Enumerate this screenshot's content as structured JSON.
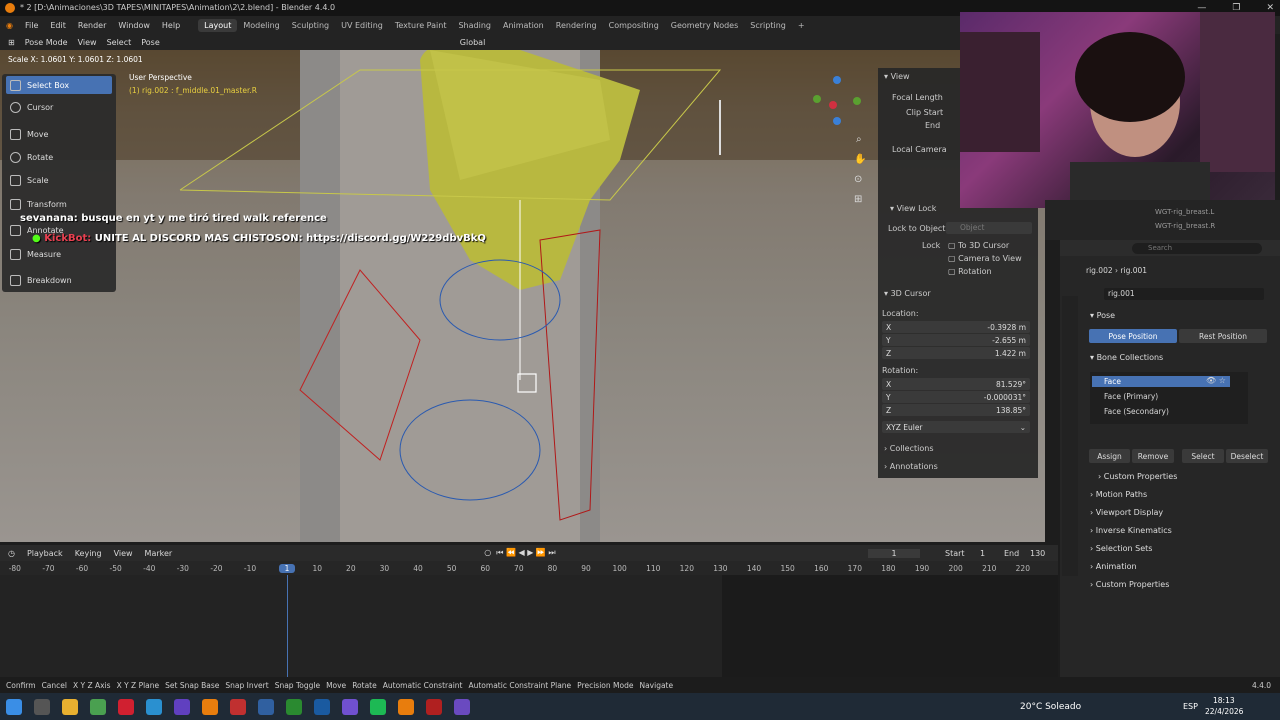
{
  "window": {
    "title": "* 2 [D:\\Animaciones\\3D TAPES\\MINITAPES\\Animation\\2\\2.blend] - Blender 4.4.0"
  },
  "menu": [
    "File",
    "Edit",
    "Render",
    "Window",
    "Help"
  ],
  "workspaces": [
    "Layout",
    "Modeling",
    "Sculpting",
    "UV Editing",
    "Texture Paint",
    "Shading",
    "Animation",
    "Rendering",
    "Compositing",
    "Geometry Nodes",
    "Scripting"
  ],
  "viewport_header": {
    "mode": "Pose Mode",
    "view": "View",
    "select": "Select",
    "pose": "Pose",
    "orientation": "Global"
  },
  "scale_readout": "Scale X: 1.0601   Y: 1.0601   Z: 1.0601",
  "overlay_text": {
    "perspective": "User Perspective",
    "object": "(1) rig.002 : f_middle.01_master.R"
  },
  "tools": [
    "Select Box",
    "Cursor",
    "Move",
    "Rotate",
    "Scale",
    "Transform",
    "Annotate",
    "Measure",
    "Breakdown"
  ],
  "chat": [
    {
      "user": "sevanana:",
      "msg": "busque en yt y me tiró tired walk reference"
    },
    {
      "user": "KickBot:",
      "msg": "UNITE AL DISCORD MAS CHISTOSON: https://discord.gg/W229dbvBkQ"
    }
  ],
  "npanel": {
    "view_title": "View",
    "focal_length": "Focal Length",
    "clip_start": "Clip Start",
    "end": "End",
    "local_camera": "Local Camera",
    "view_lock": "View Lock",
    "lock_to_object": "Lock to Object",
    "object_placeholder": "Object",
    "lock": "Lock",
    "to_3d_cursor": "To 3D Cursor",
    "camera_to_view": "Camera to View",
    "rotation": "Rotation",
    "cursor_title": "3D Cursor",
    "location": "Location:",
    "loc": [
      {
        "k": "X",
        "v": "-0.3928 m"
      },
      {
        "k": "Y",
        "v": "-2.655 m"
      },
      {
        "k": "Z",
        "v": "1.422 m"
      }
    ],
    "rotation_label": "Rotation:",
    "rot": [
      {
        "k": "X",
        "v": "81.529°"
      },
      {
        "k": "Y",
        "v": "-0.000031°"
      },
      {
        "k": "Z",
        "v": "138.85°"
      }
    ],
    "euler": "XYZ Euler",
    "collections": "Collections",
    "annotations": "Annotations"
  },
  "outliner": [
    "WGT-rig_breast.L",
    "WGT-rig_breast.R"
  ],
  "props": {
    "search_placeholder": "Search",
    "breadcrumb": [
      "rig.002",
      "rig.001"
    ],
    "armature": "rig.001",
    "pose": "Pose",
    "pose_position": "Pose Position",
    "rest_position": "Rest Position",
    "bone_collections": "Bone Collections",
    "collections": [
      "Face",
      "Face (Primary)",
      "Face (Secondary)"
    ],
    "assign": "Assign",
    "remove": "Remove",
    "select": "Select",
    "deselect": "Deselect",
    "custom_props_inner": "Custom Properties",
    "sections": [
      "Motion Paths",
      "Viewport Display",
      "Inverse Kinematics",
      "Selection Sets",
      "Animation",
      "Custom Properties"
    ]
  },
  "timeline": {
    "playback": "Playback",
    "keying": "Keying",
    "view": "View",
    "marker": "Marker",
    "frame": "1",
    "start_label": "Start",
    "start": "1",
    "end_label": "End",
    "end": "130",
    "ticks": [
      "-80",
      "-70",
      "-60",
      "-50",
      "-40",
      "-30",
      "-20",
      "-10",
      "1",
      "10",
      "20",
      "30",
      "40",
      "50",
      "60",
      "70",
      "80",
      "90",
      "100",
      "110",
      "120",
      "130",
      "140",
      "150",
      "160",
      "170",
      "180",
      "190",
      "200",
      "210",
      "220"
    ]
  },
  "status": [
    "Confirm",
    "Cancel",
    "X Y Z Axis",
    "X Y Z Plane",
    "Set Snap Base",
    "Snap Invert",
    "Snap Toggle",
    "Move",
    "Rotate",
    "Automatic Constraint",
    "Automatic Constraint Plane",
    "Precision Mode",
    "Navigate"
  ],
  "version": "4.4.0",
  "taskbar": {
    "weather": "20°C  Soleado",
    "lang": "ESP",
    "time": "18:13",
    "date": "22/4/2026"
  },
  "colors": {
    "accent": "#4772b3",
    "active_frame": "#4772b3",
    "header": "#2a2a2a"
  }
}
